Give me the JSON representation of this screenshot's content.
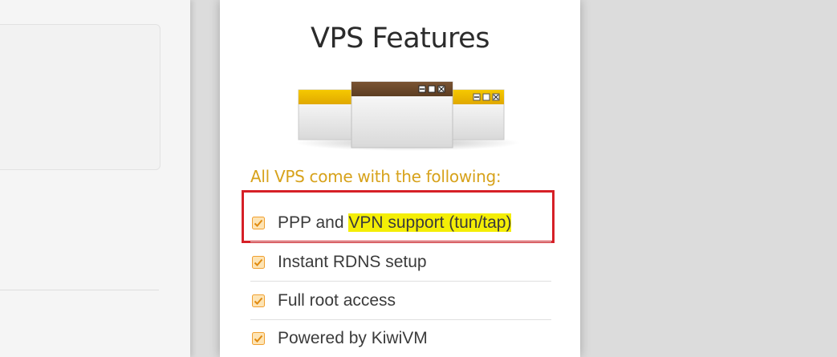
{
  "card": {
    "title": "VPS Features",
    "subtitle": "All VPS come with the following:"
  },
  "features": [
    {
      "label_prefix": "PPP and ",
      "label_highlight": "VPN support (tun/tap)",
      "checked": true,
      "highlighted": true
    },
    {
      "label": "Instant RDNS setup",
      "checked": true
    },
    {
      "label": "Full root access",
      "checked": true
    },
    {
      "label": "Powered by KiwiVM",
      "checked": true
    }
  ],
  "colors": {
    "accent": "#d7a21b",
    "highlight": "#f4ee06",
    "annotation_box": "#d62027",
    "checkbox_orange": "#f0a030"
  },
  "icons": {
    "checkbox": "checkbox-checked-icon",
    "illustration": "windows-illustration"
  }
}
